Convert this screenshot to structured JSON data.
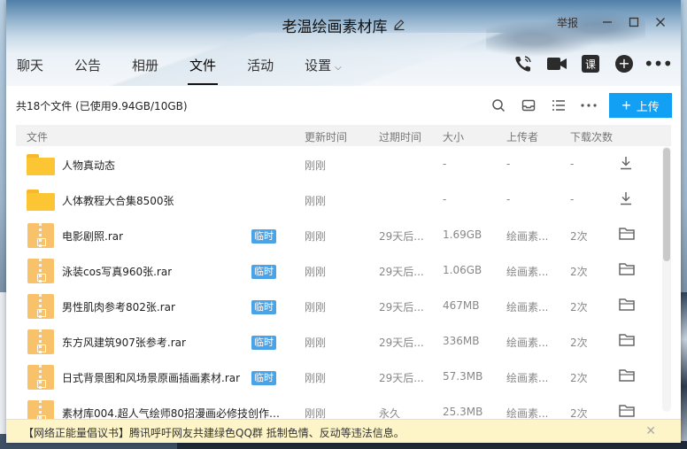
{
  "window": {
    "title": "老温绘画素材库",
    "report_label": "举报",
    "min_label": "—",
    "max_label": "☐",
    "close_label": "✕"
  },
  "tabs": [
    {
      "label": "聊天"
    },
    {
      "label": "公告"
    },
    {
      "label": "相册"
    },
    {
      "label": "文件",
      "active": true
    },
    {
      "label": "活动"
    },
    {
      "label": "设置",
      "caret": "⌵"
    }
  ],
  "tab_icons": [
    "phone-icon",
    "video-icon",
    "class-icon",
    "add-app-icon",
    "more-icon"
  ],
  "tab_icon_texts": {
    "class": "课",
    "add": "+",
    "more": "•••"
  },
  "toolbar": {
    "summary": "共18个文件 (已使用9.94GB/10GB)",
    "upload_label": "上传",
    "upload_color": "#12a0f5"
  },
  "columns": {
    "file": "文件",
    "updated": "更新时间",
    "expires": "过期时间",
    "size": "大小",
    "uploader": "上传者",
    "downloads": "下载次数"
  },
  "rows": [
    {
      "type": "folder",
      "name": "人物真动态",
      "temp": "",
      "updated": "刚刚",
      "expires": "",
      "size": "-",
      "uploader": "-",
      "downloads": "-",
      "action": "download-icon"
    },
    {
      "type": "folder",
      "name": "人体教程大合集8500张",
      "temp": "",
      "updated": "刚刚",
      "expires": "",
      "size": "-",
      "uploader": "-",
      "downloads": "-",
      "action": "download-icon"
    },
    {
      "type": "rar",
      "name": "电影剧照.rar",
      "temp": "临时",
      "updated": "刚刚",
      "expires": "29天后...",
      "size": "1.69GB",
      "uploader": "绘画素...",
      "downloads": "2次",
      "action": "folder-open-icon"
    },
    {
      "type": "rar",
      "name": "泳装cos写真960张.rar",
      "temp": "临时",
      "updated": "刚刚",
      "expires": "29天后...",
      "size": "1.06GB",
      "uploader": "绘画素...",
      "downloads": "2次",
      "action": "folder-open-icon"
    },
    {
      "type": "rar",
      "name": "男性肌肉参考802张.rar",
      "temp": "临时",
      "updated": "刚刚",
      "expires": "29天后...",
      "size": "467MB",
      "uploader": "绘画素...",
      "downloads": "2次",
      "action": "folder-open-icon"
    },
    {
      "type": "rar",
      "name": "东方风建筑907张参考.rar",
      "temp": "临时",
      "updated": "刚刚",
      "expires": "29天后...",
      "size": "336MB",
      "uploader": "绘画素...",
      "downloads": "2次",
      "action": "folder-open-icon"
    },
    {
      "type": "rar",
      "name": "日式背景图和风场景原画插画素材.rar",
      "temp": "临时",
      "updated": "刚刚",
      "expires": "29天后...",
      "size": "57.3MB",
      "uploader": "绘画素...",
      "downloads": "2次",
      "action": "folder-open-icon"
    },
    {
      "type": "rar",
      "name": "素材库004.超人气绘师80招漫画必修技创作教...",
      "temp": "",
      "updated": "刚刚",
      "expires": "永久",
      "size": "25.3MB",
      "uploader": "绘画素...",
      "downloads": "2次",
      "action": "folder-open-icon"
    }
  ],
  "notice": {
    "text": "【网络正能量倡议书】腾讯呼吁网友共建绿色QQ群 抵制色情、反动等违法信息。",
    "close": "✕"
  }
}
